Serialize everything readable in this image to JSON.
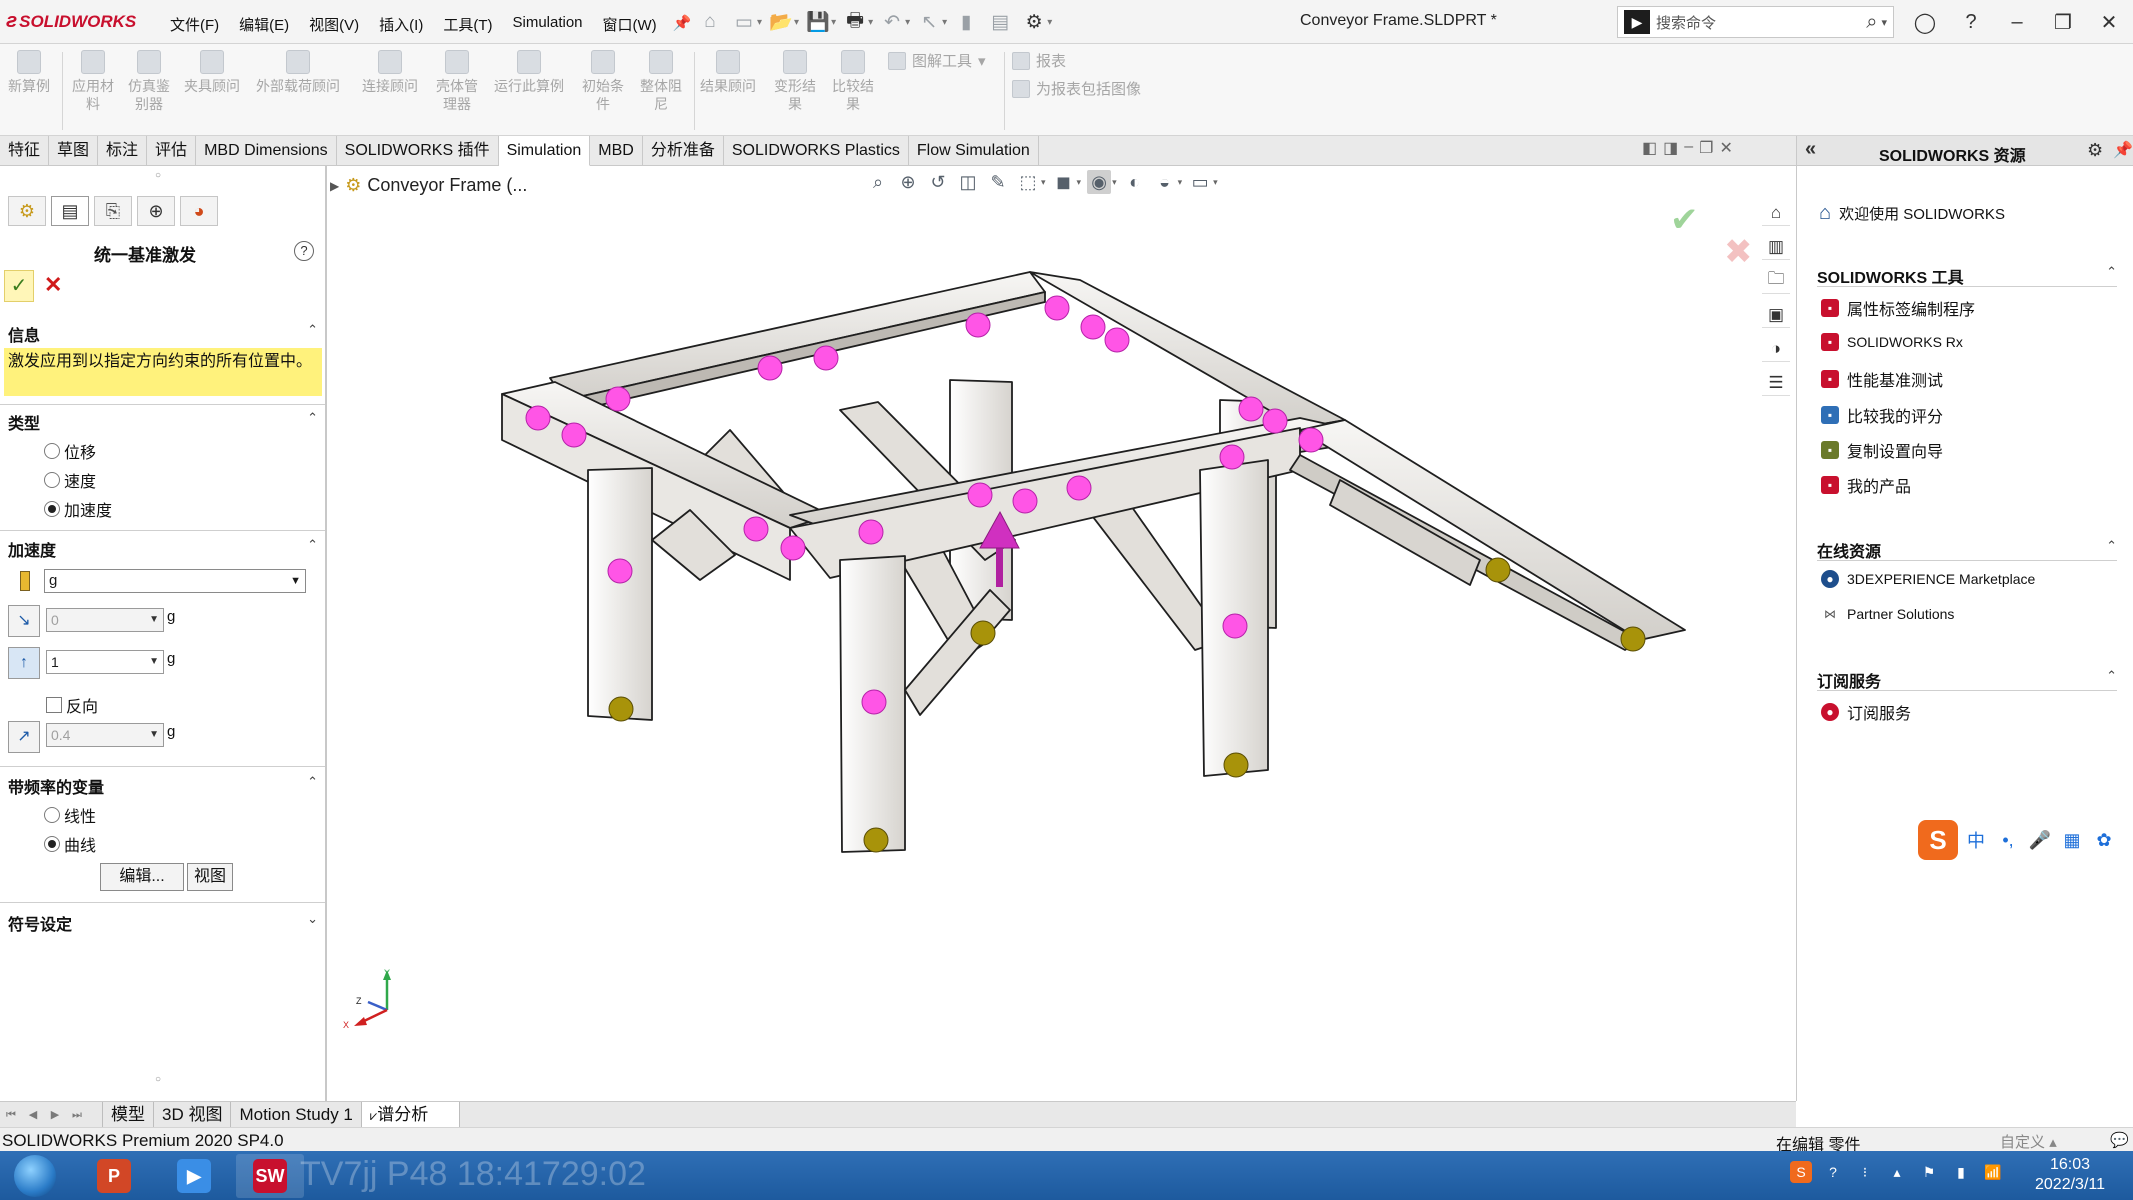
{
  "app": {
    "brand": "SOLIDWORKS",
    "document_title": "Conveyor Frame.SLDPRT *",
    "menu": [
      "文件(F)",
      "编辑(E)",
      "视图(V)",
      "插入(I)",
      "工具(T)",
      "Simulation",
      "窗口(W)"
    ],
    "search_placeholder": "搜索命令"
  },
  "ribbon": {
    "buttons": [
      {
        "label": "新算例",
        "icon": "new-study-icon"
      },
      {
        "label": "应用材\n料",
        "icon": "apply-material-icon"
      },
      {
        "label": "仿真鉴\n别器",
        "icon": "simulation-evaluator-icon"
      },
      {
        "label": "夹具顾问",
        "icon": "fixtures-advisor-icon"
      },
      {
        "label": "外部载荷顾问",
        "icon": "external-loads-advisor-icon"
      },
      {
        "label": "连接顾问",
        "icon": "connections-advisor-icon"
      },
      {
        "label": "壳体管\n理器",
        "icon": "shell-manager-icon"
      },
      {
        "label": "运行此算例",
        "icon": "run-study-icon"
      },
      {
        "label": "初始条\n件",
        "icon": "initial-conditions-icon"
      },
      {
        "label": "整体阻\n尼",
        "icon": "global-damping-icon"
      },
      {
        "label": "结果顾问",
        "icon": "results-advisor-icon"
      },
      {
        "label": "变形结\n果",
        "icon": "deformed-result-icon"
      },
      {
        "label": "比较结\n果",
        "icon": "compare-results-icon"
      }
    ],
    "plot_tools": "图解工具",
    "report": "报表",
    "include_image": "为报表包括图像"
  },
  "tabs": [
    {
      "label": "特征",
      "active": false
    },
    {
      "label": "草图",
      "active": false
    },
    {
      "label": "标注",
      "active": false
    },
    {
      "label": "评估",
      "active": false
    },
    {
      "label": "MBD Dimensions",
      "active": false
    },
    {
      "label": "SOLIDWORKS 插件",
      "active": false
    },
    {
      "label": "Simulation",
      "active": true
    },
    {
      "label": "MBD",
      "active": false
    },
    {
      "label": "分析准备",
      "active": false
    },
    {
      "label": "SOLIDWORKS Plastics",
      "active": false
    },
    {
      "label": "Flow Simulation",
      "active": false
    }
  ],
  "property_manager": {
    "title": "统一基准激发",
    "info": {
      "header": "信息",
      "message": "激发应用到以指定方向约束的所有位置中。"
    },
    "type": {
      "header": "类型",
      "options": [
        {
          "label": "位移",
          "selected": false
        },
        {
          "label": "速度",
          "selected": false
        },
        {
          "label": "加速度",
          "selected": true
        }
      ]
    },
    "acceleration": {
      "header": "加速度",
      "unit": "g",
      "dir1_value": "0",
      "dir2_value": "1",
      "reverse_label": "反向",
      "dir3_value": "0.4",
      "unit_suffix": "g"
    },
    "frequency_variation": {
      "header": "带频率的变量",
      "options": [
        {
          "label": "线性",
          "selected": false
        },
        {
          "label": "曲线",
          "selected": true
        }
      ],
      "edit_button": "编辑...",
      "view_button": "视图"
    },
    "symbol_settings": {
      "header": "符号设定"
    }
  },
  "graphics": {
    "tree_item": "Conveyor Frame (..."
  },
  "task_pane": {
    "title": "SOLIDWORKS 资源",
    "welcome": "欢迎使用 SOLIDWORKS",
    "tools": {
      "header": "SOLIDWORKS 工具",
      "items": [
        "属性标签编制程序",
        "SOLIDWORKS Rx",
        "性能基准测试",
        "比较我的评分",
        "复制设置向导",
        "我的产品"
      ]
    },
    "online": {
      "header": "在线资源",
      "items": [
        "3DEXPERIENCE Marketplace",
        "Partner Solutions"
      ]
    },
    "subscription": {
      "header": "订阅服务",
      "items": [
        "订阅服务"
      ]
    },
    "ime": [
      "中",
      "•,",
      "🎤",
      "▦",
      "✿"
    ]
  },
  "bottom_tabs": [
    {
      "label": "模型",
      "active": false
    },
    {
      "label": "3D 视图",
      "active": false
    },
    {
      "label": "Motion Study 1",
      "active": false
    },
    {
      "label": "谱分析",
      "active": true
    }
  ],
  "status": {
    "version": "SOLIDWORKS Premium 2020 SP4.0",
    "mode": "在编辑 零件",
    "custom": "自定义"
  },
  "taskbar": {
    "watermark": "TV7jj P48 18:41729:02",
    "time": "16:03",
    "date": "2022/3/11"
  },
  "colors": {
    "brand_red": "#c8102e",
    "load_point": "#ff55e6",
    "fixture_point": "#a8930a",
    "info_yellow": "#fff27c",
    "taskbar_blue": "#1d5a9e"
  }
}
